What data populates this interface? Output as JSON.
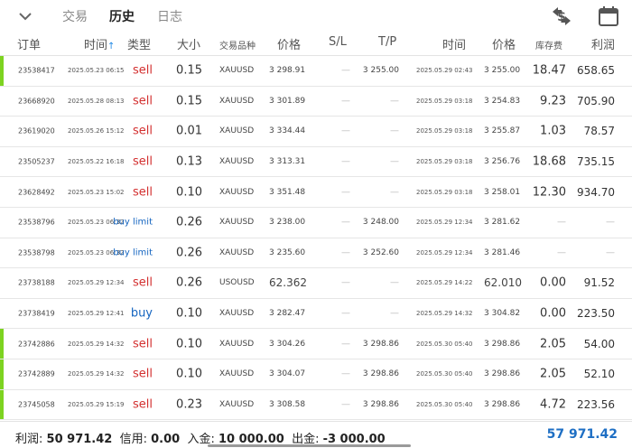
{
  "tabs": [
    {
      "label": "交易",
      "active": false
    },
    {
      "label": "历史",
      "active": true
    },
    {
      "label": "日志",
      "active": false
    }
  ],
  "headers": {
    "order": "订单",
    "time": "时间",
    "sort_arrow": "↑",
    "type": "类型",
    "volume": "大小",
    "symbol": "交易品种",
    "price": "价格",
    "sl": "S/L",
    "tp": "T/P",
    "close_time": "时间",
    "close_price": "价格",
    "swap": "库存费",
    "profit": "利润"
  },
  "rows": [
    {
      "id": "23538417",
      "open_time": "2025.05.23 06:15",
      "type": "sell",
      "volume": "0.15",
      "symbol": "XAUUSD",
      "open_price": "3 298.91",
      "sl": "—",
      "tp": "3 255.00",
      "close_time": "2025.05.29 02:43",
      "close_price": "3 255.00",
      "swap": "18.47",
      "profit": "658.65",
      "marker": true
    },
    {
      "id": "23668920",
      "open_time": "2025.05.28 08:13",
      "type": "sell",
      "volume": "0.15",
      "symbol": "XAUUSD",
      "open_price": "3 301.89",
      "sl": "—",
      "tp": "—",
      "close_time": "2025.05.29 03:18",
      "close_price": "3 254.83",
      "swap": "9.23",
      "profit": "705.90",
      "marker": false
    },
    {
      "id": "23619020",
      "open_time": "2025.05.26 15:12",
      "type": "sell",
      "volume": "0.01",
      "symbol": "XAUUSD",
      "open_price": "3 334.44",
      "sl": "—",
      "tp": "—",
      "close_time": "2025.05.29 03:18",
      "close_price": "3 255.87",
      "swap": "1.03",
      "profit": "78.57",
      "marker": false
    },
    {
      "id": "23505237",
      "open_time": "2025.05.22 16:18",
      "type": "sell",
      "volume": "0.13",
      "symbol": "XAUUSD",
      "open_price": "3 313.31",
      "sl": "—",
      "tp": "—",
      "close_time": "2025.05.29 03:18",
      "close_price": "3 256.76",
      "swap": "18.68",
      "profit": "735.15",
      "marker": false
    },
    {
      "id": "23628492",
      "open_time": "2025.05.23 15:02",
      "type": "sell",
      "volume": "0.10",
      "symbol": "XAUUSD",
      "open_price": "3 351.48",
      "sl": "—",
      "tp": "—",
      "close_time": "2025.05.29 03:18",
      "close_price": "3 258.01",
      "swap": "12.30",
      "profit": "934.70",
      "marker": false
    },
    {
      "id": "23538796",
      "open_time": "2025.05.23 06:32",
      "type": "buy limit",
      "volume": "0.26",
      "symbol": "XAUUSD",
      "open_price": "3 238.00",
      "sl": "—",
      "tp": "3 248.00",
      "close_time": "2025.05.29 12:34",
      "close_price": "3 281.62",
      "swap": "—",
      "profit": "—",
      "marker": false
    },
    {
      "id": "23538798",
      "open_time": "2025.05.23 06:32",
      "type": "buy limit",
      "volume": "0.26",
      "symbol": "XAUUSD",
      "open_price": "3 235.60",
      "sl": "—",
      "tp": "3 252.60",
      "close_time": "2025.05.29 12:34",
      "close_price": "3 281.46",
      "swap": "—",
      "profit": "—",
      "marker": false
    },
    {
      "id": "23738188",
      "open_time": "2025.05.29 12:34",
      "type": "sell",
      "volume": "0.26",
      "symbol": "USOUSD",
      "open_price": "62.362",
      "sl": "—",
      "tp": "—",
      "close_time": "2025.05.29 14:22",
      "close_price": "62.010",
      "swap": "0.00",
      "profit": "91.52",
      "marker": false
    },
    {
      "id": "23738419",
      "open_time": "2025.05.29 12:41",
      "type": "buy",
      "volume": "0.10",
      "symbol": "XAUUSD",
      "open_price": "3 282.47",
      "sl": "—",
      "tp": "—",
      "close_time": "2025.05.29 14:32",
      "close_price": "3 304.82",
      "swap": "0.00",
      "profit": "223.50",
      "marker": false
    },
    {
      "id": "23742886",
      "open_time": "2025.05.29 14:32",
      "type": "sell",
      "volume": "0.10",
      "symbol": "XAUUSD",
      "open_price": "3 304.26",
      "sl": "—",
      "tp": "3 298.86",
      "close_time": "2025.05.30 05:40",
      "close_price": "3 298.86",
      "swap": "2.05",
      "profit": "54.00",
      "marker": true
    },
    {
      "id": "23742889",
      "open_time": "2025.05.29 14:32",
      "type": "sell",
      "volume": "0.10",
      "symbol": "XAUUSD",
      "open_price": "3 304.07",
      "sl": "—",
      "tp": "3 298.86",
      "close_time": "2025.05.30 05:40",
      "close_price": "3 298.86",
      "swap": "2.05",
      "profit": "52.10",
      "marker": true
    },
    {
      "id": "23745058",
      "open_time": "2025.05.29 15:19",
      "type": "sell",
      "volume": "0.23",
      "symbol": "XAUUSD",
      "open_price": "3 308.58",
      "sl": "—",
      "tp": "3 298.86",
      "close_time": "2025.05.30 05:40",
      "close_price": "3 298.86",
      "swap": "4.72",
      "profit": "223.56",
      "marker": true
    }
  ],
  "footer": {
    "profit_label": "利润:",
    "profit_value": "50 971.42",
    "credit_label": "信用:",
    "credit_value": "0.00",
    "deposit_label": "入金:",
    "deposit_value": "10 000.00",
    "withdraw_label": "出金:",
    "withdraw_value": "-3 000.00",
    "total": "57 971.42"
  },
  "colors": {
    "marker": "#7dd321",
    "sell": "#d32f2f",
    "buy": "#1565c0",
    "total": "#1e6fc4"
  },
  "icons": {
    "collapse": "chevron-down-icon",
    "currency": "currency-exchange-icon",
    "calendar": "calendar-icon"
  }
}
